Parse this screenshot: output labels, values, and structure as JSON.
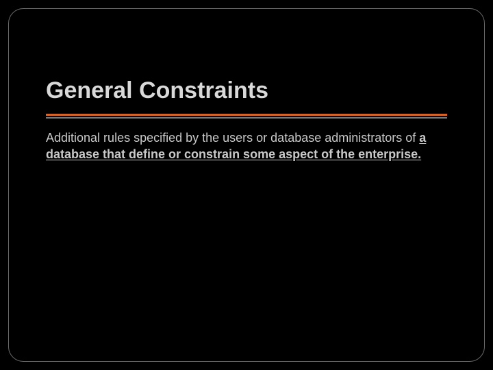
{
  "slide": {
    "title": "General Constraints",
    "body_normal": "Additional rules specified by the users or database administrators of ",
    "body_bold": "a database that define or constrain some aspect of the enterprise."
  }
}
